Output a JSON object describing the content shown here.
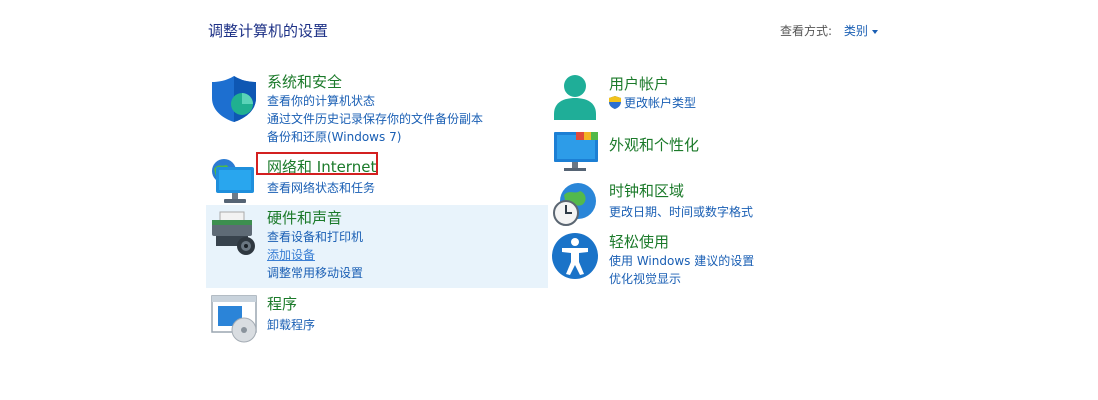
{
  "header": {
    "title": "调整计算机的设置",
    "view_by_label": "查看方式:",
    "view_by_value": "类别"
  },
  "left": [
    {
      "title": "系统和安全",
      "links": [
        "查看你的计算机状态",
        "通过文件历史记录保存你的文件备份副本",
        "备份和还原(Windows 7)"
      ]
    },
    {
      "title": "网络和 Internet",
      "links": [
        "查看网络状态和任务"
      ]
    },
    {
      "title": "硬件和声音",
      "links": [
        "查看设备和打印机",
        "添加设备",
        "调整常用移动设置"
      ]
    },
    {
      "title": "程序",
      "links": [
        "卸载程序"
      ]
    }
  ],
  "right": [
    {
      "title": "用户帐户",
      "links": [
        "更改帐户类型"
      ]
    },
    {
      "title": "外观和个性化",
      "links": []
    },
    {
      "title": "时钟和区域",
      "links": [
        "更改日期、时间或数字格式"
      ]
    },
    {
      "title": "轻松使用",
      "links": [
        "使用 Windows 建议的设置",
        "优化视觉显示"
      ]
    }
  ],
  "colors": {
    "title_green": "#1b7a2a",
    "link_blue": "#1a5fb4",
    "highlight_box": "#d32020",
    "hover_bg": "#e8f3fb"
  }
}
